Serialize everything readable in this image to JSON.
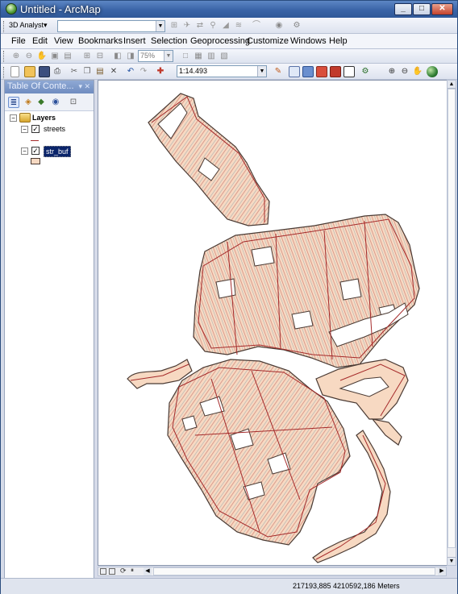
{
  "window": {
    "title": "Untitled - ArcMap",
    "min_label": "_",
    "max_label": "□",
    "close_label": "✕"
  },
  "toolbar3d": {
    "name": "3D Analyst",
    "arrow": "▾",
    "layer_value": "",
    "icons": [
      "raster-icon",
      "fly-icon",
      "navigate-icon",
      "walk-icon",
      "steepest-icon",
      "contour-icon",
      "profile-icon",
      "observer-icon",
      "help-icon"
    ]
  },
  "menu": {
    "items": [
      "File",
      "Edit",
      "View",
      "Bookmarks",
      "Insert",
      "Selection",
      "Geoprocessing",
      "Customize",
      "Windows",
      "Help"
    ]
  },
  "layout_toolbar": {
    "zoom_value": "75%",
    "icons": [
      "zoom-in-page-icon",
      "zoom-out-page-icon",
      "pan-page-icon",
      "zoom-whole-page-icon",
      "zoom-100-icon",
      "zoom-in-fixed-icon",
      "zoom-out-fixed-icon",
      "go-back-icon",
      "go-forward-icon",
      "toggle-draft-icon",
      "focus-data-frame-icon",
      "change-layout-icon",
      "data-driven-pages-icon"
    ]
  },
  "standard_toolbar": {
    "scale_value": "1:14.493",
    "icons": [
      "new-icon",
      "open-icon",
      "save-icon",
      "print-icon",
      "cut-icon",
      "copy-icon",
      "paste-icon",
      "delete-icon",
      "undo-icon",
      "redo-icon",
      "add-data-icon",
      "editor-icon",
      "toc-icon",
      "catalog-icon",
      "search-icon",
      "arctoolbox-icon",
      "python-icon",
      "model-builder-icon",
      "zoom-in-icon",
      "zoom-out-icon",
      "pan-icon",
      "full-extent-icon"
    ]
  },
  "toc": {
    "title": "Table Of Conte...",
    "pin": "▾ ✕",
    "root": "Layers",
    "layers": [
      {
        "name": "streets",
        "checked": "✓",
        "expand": "−"
      },
      {
        "name": "str_buf",
        "checked": "✓",
        "expand": "−"
      }
    ]
  },
  "statusbar": {
    "coords": "217193,885  4210592,186 Meters"
  },
  "colors": {
    "buffer_fill": "#f7d9c2",
    "buffer_outline": "#4a3a33",
    "street_line": "#a52a2a"
  }
}
